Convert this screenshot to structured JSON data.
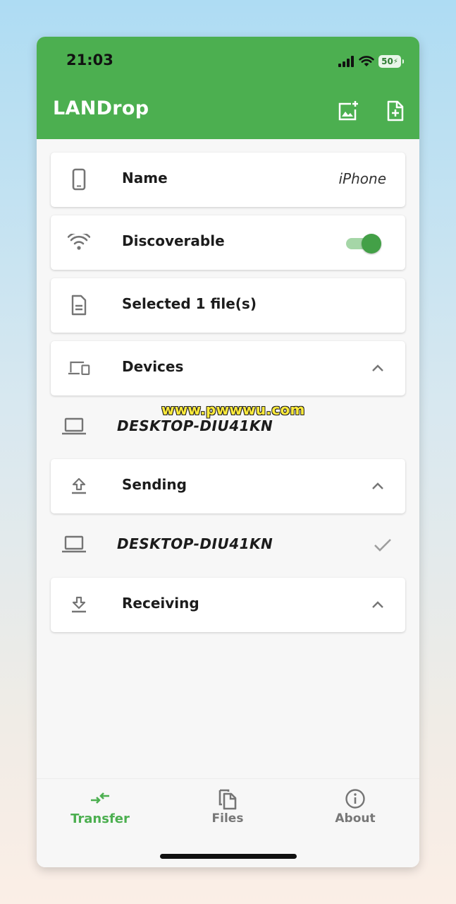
{
  "status_bar": {
    "time": "21:03",
    "battery": "50"
  },
  "app_bar": {
    "title": "LANDrop",
    "actions": [
      "add-photo-icon",
      "add-file-icon"
    ]
  },
  "settings": {
    "name_label": "Name",
    "name_value": "iPhone",
    "discoverable_label": "Discoverable",
    "discoverable_on": true,
    "selected_label": "Selected 1 file(s)"
  },
  "sections": {
    "devices_label": "Devices",
    "sending_label": "Sending",
    "receiving_label": "Receiving"
  },
  "devices": [
    {
      "name": "DESKTOP-DIU41KN"
    }
  ],
  "sending": [
    {
      "name": "DESKTOP-DIU41KN",
      "status": "done"
    }
  ],
  "watermark": "www.pwwwu.com",
  "bottom_nav": {
    "items": [
      {
        "label": "Transfer",
        "icon": "transfer-icon",
        "active": true
      },
      {
        "label": "Files",
        "icon": "files-icon",
        "active": false
      },
      {
        "label": "About",
        "icon": "info-icon",
        "active": false
      }
    ]
  },
  "colors": {
    "primary": "#4caf50",
    "toggle_thumb": "#43a047",
    "toggle_track": "#a5d6a7",
    "icon_gray": "#757575"
  }
}
